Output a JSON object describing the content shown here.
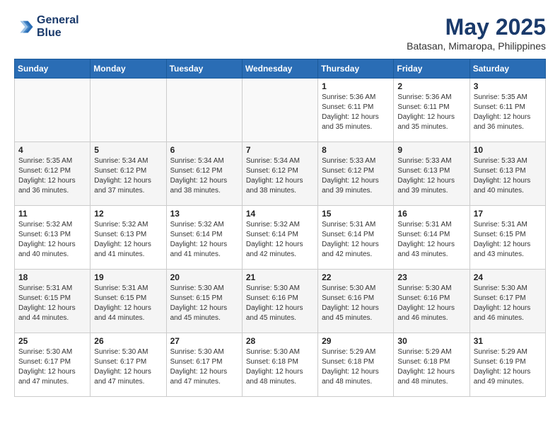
{
  "header": {
    "logo_line1": "General",
    "logo_line2": "Blue",
    "month": "May 2025",
    "location": "Batasan, Mimaropa, Philippines"
  },
  "weekdays": [
    "Sunday",
    "Monday",
    "Tuesday",
    "Wednesday",
    "Thursday",
    "Friday",
    "Saturday"
  ],
  "weeks": [
    [
      {
        "day": "",
        "info": ""
      },
      {
        "day": "",
        "info": ""
      },
      {
        "day": "",
        "info": ""
      },
      {
        "day": "",
        "info": ""
      },
      {
        "day": "1",
        "info": "Sunrise: 5:36 AM\nSunset: 6:11 PM\nDaylight: 12 hours\nand 35 minutes."
      },
      {
        "day": "2",
        "info": "Sunrise: 5:36 AM\nSunset: 6:11 PM\nDaylight: 12 hours\nand 35 minutes."
      },
      {
        "day": "3",
        "info": "Sunrise: 5:35 AM\nSunset: 6:11 PM\nDaylight: 12 hours\nand 36 minutes."
      }
    ],
    [
      {
        "day": "4",
        "info": "Sunrise: 5:35 AM\nSunset: 6:12 PM\nDaylight: 12 hours\nand 36 minutes."
      },
      {
        "day": "5",
        "info": "Sunrise: 5:34 AM\nSunset: 6:12 PM\nDaylight: 12 hours\nand 37 minutes."
      },
      {
        "day": "6",
        "info": "Sunrise: 5:34 AM\nSunset: 6:12 PM\nDaylight: 12 hours\nand 38 minutes."
      },
      {
        "day": "7",
        "info": "Sunrise: 5:34 AM\nSunset: 6:12 PM\nDaylight: 12 hours\nand 38 minutes."
      },
      {
        "day": "8",
        "info": "Sunrise: 5:33 AM\nSunset: 6:12 PM\nDaylight: 12 hours\nand 39 minutes."
      },
      {
        "day": "9",
        "info": "Sunrise: 5:33 AM\nSunset: 6:13 PM\nDaylight: 12 hours\nand 39 minutes."
      },
      {
        "day": "10",
        "info": "Sunrise: 5:33 AM\nSunset: 6:13 PM\nDaylight: 12 hours\nand 40 minutes."
      }
    ],
    [
      {
        "day": "11",
        "info": "Sunrise: 5:32 AM\nSunset: 6:13 PM\nDaylight: 12 hours\nand 40 minutes."
      },
      {
        "day": "12",
        "info": "Sunrise: 5:32 AM\nSunset: 6:13 PM\nDaylight: 12 hours\nand 41 minutes."
      },
      {
        "day": "13",
        "info": "Sunrise: 5:32 AM\nSunset: 6:14 PM\nDaylight: 12 hours\nand 41 minutes."
      },
      {
        "day": "14",
        "info": "Sunrise: 5:32 AM\nSunset: 6:14 PM\nDaylight: 12 hours\nand 42 minutes."
      },
      {
        "day": "15",
        "info": "Sunrise: 5:31 AM\nSunset: 6:14 PM\nDaylight: 12 hours\nand 42 minutes."
      },
      {
        "day": "16",
        "info": "Sunrise: 5:31 AM\nSunset: 6:14 PM\nDaylight: 12 hours\nand 43 minutes."
      },
      {
        "day": "17",
        "info": "Sunrise: 5:31 AM\nSunset: 6:15 PM\nDaylight: 12 hours\nand 43 minutes."
      }
    ],
    [
      {
        "day": "18",
        "info": "Sunrise: 5:31 AM\nSunset: 6:15 PM\nDaylight: 12 hours\nand 44 minutes."
      },
      {
        "day": "19",
        "info": "Sunrise: 5:31 AM\nSunset: 6:15 PM\nDaylight: 12 hours\nand 44 minutes."
      },
      {
        "day": "20",
        "info": "Sunrise: 5:30 AM\nSunset: 6:15 PM\nDaylight: 12 hours\nand 45 minutes."
      },
      {
        "day": "21",
        "info": "Sunrise: 5:30 AM\nSunset: 6:16 PM\nDaylight: 12 hours\nand 45 minutes."
      },
      {
        "day": "22",
        "info": "Sunrise: 5:30 AM\nSunset: 6:16 PM\nDaylight: 12 hours\nand 45 minutes."
      },
      {
        "day": "23",
        "info": "Sunrise: 5:30 AM\nSunset: 6:16 PM\nDaylight: 12 hours\nand 46 minutes."
      },
      {
        "day": "24",
        "info": "Sunrise: 5:30 AM\nSunset: 6:17 PM\nDaylight: 12 hours\nand 46 minutes."
      }
    ],
    [
      {
        "day": "25",
        "info": "Sunrise: 5:30 AM\nSunset: 6:17 PM\nDaylight: 12 hours\nand 47 minutes."
      },
      {
        "day": "26",
        "info": "Sunrise: 5:30 AM\nSunset: 6:17 PM\nDaylight: 12 hours\nand 47 minutes."
      },
      {
        "day": "27",
        "info": "Sunrise: 5:30 AM\nSunset: 6:17 PM\nDaylight: 12 hours\nand 47 minutes."
      },
      {
        "day": "28",
        "info": "Sunrise: 5:30 AM\nSunset: 6:18 PM\nDaylight: 12 hours\nand 48 minutes."
      },
      {
        "day": "29",
        "info": "Sunrise: 5:29 AM\nSunset: 6:18 PM\nDaylight: 12 hours\nand 48 minutes."
      },
      {
        "day": "30",
        "info": "Sunrise: 5:29 AM\nSunset: 6:18 PM\nDaylight: 12 hours\nand 48 minutes."
      },
      {
        "day": "31",
        "info": "Sunrise: 5:29 AM\nSunset: 6:19 PM\nDaylight: 12 hours\nand 49 minutes."
      }
    ]
  ]
}
